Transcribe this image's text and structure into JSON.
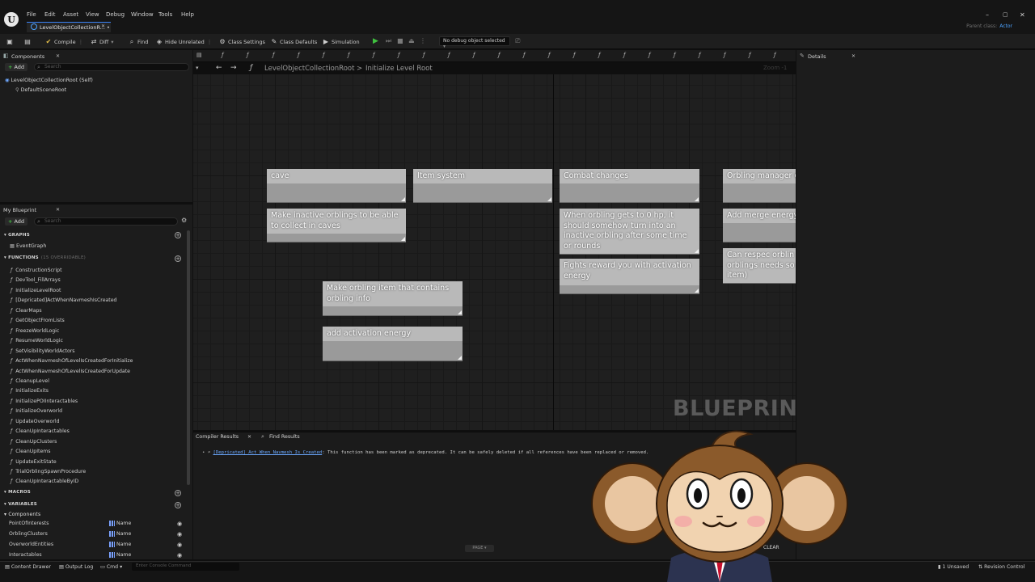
{
  "menu": {
    "items": [
      "File",
      "Edit",
      "Asset",
      "View",
      "Debug",
      "Window",
      "Tools",
      "Help"
    ],
    "tab_label": "LevelObjectCollectionR... •",
    "parent_class_label": "Parent class:",
    "parent_class_value": "Actor",
    "window_min": "–",
    "window_max": "▢",
    "window_close": "✕",
    "tab_close": "✕"
  },
  "toolbar": {
    "compile": "Compile",
    "diff": "Diff",
    "find": "Find",
    "hide_unrelated": "Hide Unrelated",
    "class_settings": "Class Settings",
    "class_defaults": "Class Defaults",
    "simulation": "Simulation",
    "debug_object": "No debug object selected"
  },
  "components_panel": {
    "title": "Components",
    "add_label": "Add",
    "search_placeholder": "Search",
    "root_item": "LevelObjectCollectionRoot (Self)",
    "child_item": "DefaultSceneRoot"
  },
  "my_blueprint": {
    "title": "My Blueprint",
    "add_label": "Add",
    "search_placeholder": "Search",
    "graphs_header": "GRAPHS",
    "event_graph": "EventGraph",
    "functions_header": "FUNCTIONS",
    "functions_sub": "(15 OVERRIDABLE)",
    "functions": [
      "ConstructionScript",
      "DevTool_FillArrays",
      "InitializeLevelRoot",
      "[Depricated]ActWhenNavmeshIsCreated",
      "ClearMaps",
      "GetObjectFromLists",
      "FreezeWorldLogic",
      "ResumeWorldLogic",
      "SetVisibilityWorldActors",
      "ActWhenNavmeshOfLevelIsCreatedForInitialize",
      "ActWhenNavmeshOfLevelIsCreatedForUpdate",
      "CleanupLevel",
      "InitializeExits",
      "InitializePOIInteractables",
      "InitializeOverworld",
      "UpdateOverworld",
      "CleanUpInteractables",
      "CleanUpClusters",
      "CleanUpItems",
      "UpdateExitState",
      "TrialOrblingSpawnProcedure",
      "CleanUpInteractableByID"
    ],
    "macros_header": "MACROS",
    "variables_header": "VARIABLES",
    "components_subheader": "Components",
    "variables": [
      {
        "name": "PointOfInterests",
        "type": "Name"
      },
      {
        "name": "OrblingClusters",
        "type": "Name"
      },
      {
        "name": "OverworldEntities",
        "type": "Name"
      },
      {
        "name": "Interactables",
        "type": "Name"
      }
    ]
  },
  "graph": {
    "breadcrumb_root": "LevelObjectCollectionRoot",
    "breadcrumb_sep": ">",
    "breadcrumb_current": "Initialize Level Root",
    "zoom": "Zoom -1",
    "watermark": "BLUEPRINT",
    "comments": [
      "cave",
      "Item system",
      "Combat changes",
      "Orbling manager c",
      "Make inactive orblings to be able to collect in caves",
      "When orbling gets to 0 hp, it should somehow turn into an inactive orbling after some time or rounds",
      "Add merge energy",
      "Fights reward you with activation energy",
      "Can respec orblin orblings needs so item)",
      "Make orbling item that contains orbling info",
      "add activation energy"
    ]
  },
  "compiler": {
    "tab_compiler": "Compiler Results",
    "tab_find": "Find Results",
    "message_link": "[Depricated] Act When Navmesh Is Created",
    "message_text": ": This function has been marked as deprecated. It can be safely deleted if all references have been replaced or removed.",
    "page_label": "PAGE",
    "clear_label": "CLEAR"
  },
  "details": {
    "title": "Details"
  },
  "statusbar": {
    "content_drawer": "Content Drawer",
    "output_log": "Output Log",
    "cmd": "Cmd",
    "console_placeholder": "Enter Console Command",
    "unsaved": "1 Unsaved",
    "revision_control": "Revision Control"
  },
  "colors": {
    "accent_blue": "#4da3ff",
    "play_green": "#3fc13f",
    "comment_body": "#9a9a9a",
    "comment_title": "#b9b9b9"
  }
}
